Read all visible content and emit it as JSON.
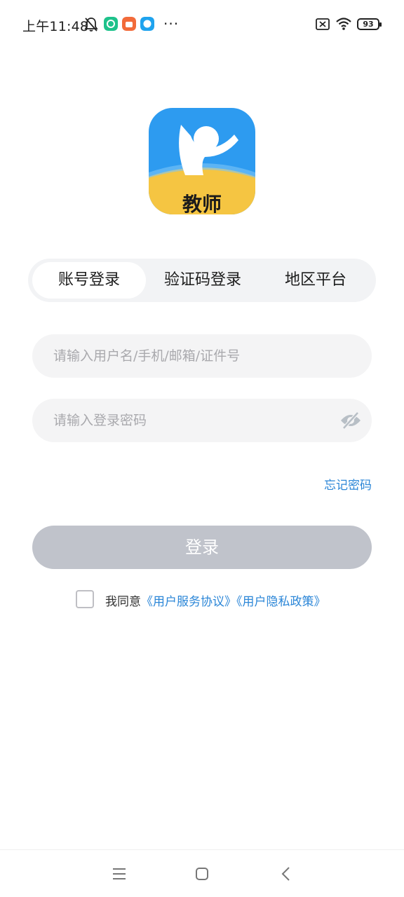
{
  "status_bar": {
    "time": "上午11:48",
    "dots": "···",
    "battery": "93"
  },
  "logo": {
    "label": "教师"
  },
  "tabs": [
    {
      "label": "账号登录",
      "active": true
    },
    {
      "label": "验证码登录",
      "active": false
    },
    {
      "label": "地区平台",
      "active": false
    }
  ],
  "form": {
    "username_placeholder": "请输入用户名/手机/邮箱/证件号",
    "username_value": "",
    "password_placeholder": "请输入登录密码",
    "password_value": "",
    "forgot_label": "忘记密码",
    "login_label": "登录"
  },
  "agreement": {
    "prefix": "我同意",
    "terms": "《用户服务协议》",
    "privacy": "《用户隐私政策》",
    "checked": false
  },
  "colors": {
    "accent": "#2b86d7",
    "logo_blue": "#2d9bf0",
    "logo_yellow": "#f5c542",
    "button_disabled": "#c0c3cb"
  }
}
